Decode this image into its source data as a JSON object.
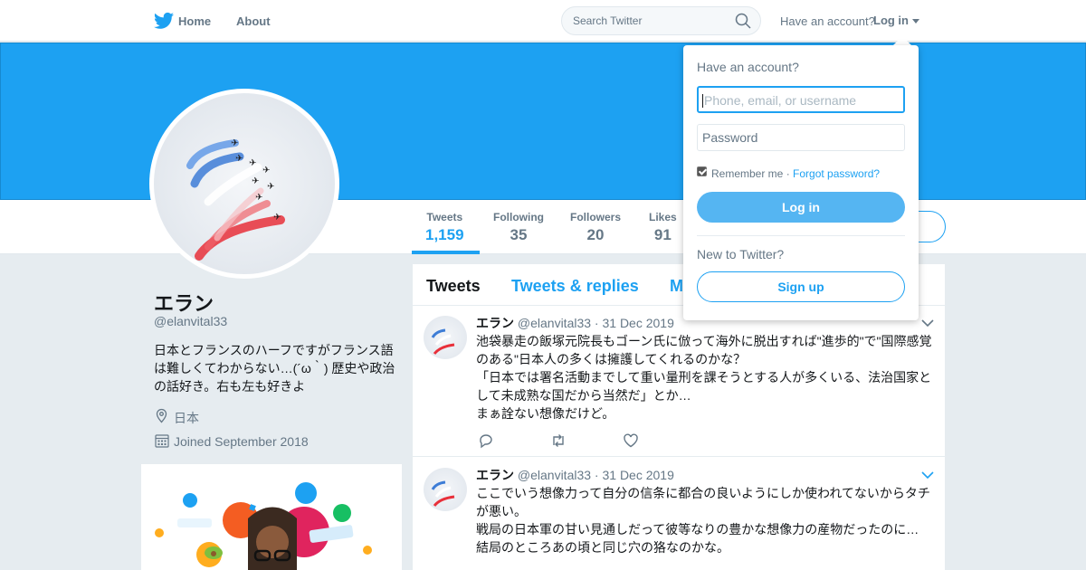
{
  "nav": {
    "home_label": "Home",
    "about_label": "About",
    "search_placeholder": "Search Twitter",
    "have_account": "Have an account?",
    "login_label": "Log in"
  },
  "profile": {
    "name": "エラン",
    "handle": "@elanvital33",
    "bio": "日本とフランスのハーフですがフランス語は難しくてわからない…(´ω｀) 歴史や政治の話好き。右も左も好きよ",
    "location": "日本",
    "joined": "Joined September 2018"
  },
  "stats": [
    {
      "label": "Tweets",
      "value": "1,159"
    },
    {
      "label": "Following",
      "value": "35"
    },
    {
      "label": "Followers",
      "value": "20"
    },
    {
      "label": "Likes",
      "value": "91"
    }
  ],
  "tabs": [
    "Tweets",
    "Tweets & replies",
    "M"
  ],
  "tweets": [
    {
      "name": "エラン",
      "meta": "@elanvital33 · 31 Dec 2019",
      "lines": [
        "池袋暴走の飯塚元院長もゴーン氏に倣って海外に脱出すれば\"進歩的\"で\"国際感覚",
        "のある\"日本人の多くは擁護してくれるのかな？",
        "「日本では署名活動までして重い量刑を課そうとする人が多くいる、法治国家と",
        "して未成熟な国だから当然だ」とか…",
        "まぁ詮ない想像だけど。"
      ]
    },
    {
      "name": "エラン",
      "meta": "@elanvital33 · 31 Dec 2019",
      "lines": [
        "ここでいう想像力って自分の信条に都合の良いようにしか使われてないからタチ",
        "が悪い。",
        "戦局の日本軍の甘い見通しだって彼等なりの豊かな想像力の産物だったのに…",
        "結局のところあの頃と同じ穴の狢なのかな。"
      ]
    }
  ],
  "login_dropdown": {
    "heading": "Have an account?",
    "username_placeholder": "Phone, email, or username",
    "password_placeholder": "Password",
    "remember_label": "Remember me",
    "separator": " · ",
    "forgot_label": "Forgot password?",
    "login_button": "Log in",
    "new_heading": "New to Twitter?",
    "signup_button": "Sign up"
  },
  "colors": {
    "accent": "#1da1f2",
    "banner": "#1da1f2",
    "background": "#e6ecf0"
  },
  "icons": [
    "twitter-bird-icon",
    "search-icon",
    "caret-down-icon",
    "location-pin-icon",
    "calendar-icon",
    "reply-icon",
    "retweet-icon",
    "like-icon",
    "chevron-down-icon"
  ]
}
